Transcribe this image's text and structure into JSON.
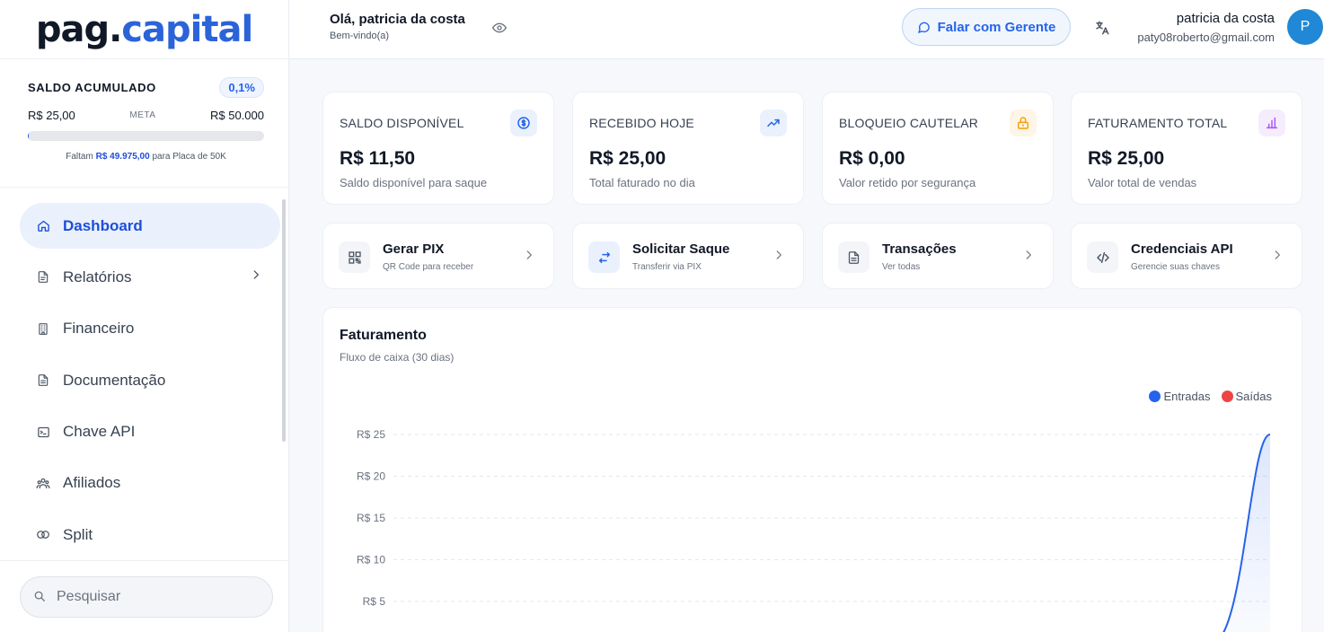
{
  "logo": {
    "part1": "pag.",
    "part2": "capital"
  },
  "saldo": {
    "title": "SALDO ACUMULADO",
    "percent": "0,1%",
    "current": "R$ 25,00",
    "meta_label": "META",
    "goal": "R$ 50.000",
    "progress_fraction": 0.0005,
    "faltam_prefix": "Faltam",
    "faltam_value": "R$ 49.975,00",
    "faltam_suffix": "para Placa de 50K"
  },
  "nav": {
    "items": [
      {
        "label": "Dashboard",
        "icon": "home-icon"
      },
      {
        "label": "Relatórios",
        "icon": "file-icon"
      },
      {
        "label": "Financeiro",
        "icon": "building-icon"
      },
      {
        "label": "Documentação",
        "icon": "document-icon"
      },
      {
        "label": "Chave API",
        "icon": "terminal-icon"
      },
      {
        "label": "Afiliados",
        "icon": "users-icon"
      },
      {
        "label": "Split",
        "icon": "split-icon"
      }
    ]
  },
  "search": {
    "placeholder": "Pesquisar"
  },
  "header": {
    "greeting": "Olá, patricia da costa",
    "welcome": "Bem-vindo(a)",
    "falar_label": "Falar com Gerente",
    "user_name": "patricia da costa",
    "user_email": "paty08roberto@gmail.com",
    "avatar_initial": "P"
  },
  "stats": [
    {
      "label": "SALDO DISPONÍVEL",
      "value": "R$ 11,50",
      "desc": "Saldo disponível para saque",
      "icon": "dollar-icon",
      "color": "#2563eb",
      "bg": "#eaf1fd"
    },
    {
      "label": "RECEBIDO HOJE",
      "value": "R$ 25,00",
      "desc": "Total faturado no dia",
      "icon": "trending-up-icon",
      "color": "#2563eb",
      "bg": "#eaf1fd"
    },
    {
      "label": "BLOQUEIO CAUTELAR",
      "value": "R$ 0,00",
      "desc": "Valor retido por segurança",
      "icon": "lock-icon",
      "color": "#f59e0b",
      "bg": "#fff5e6"
    },
    {
      "label": "FATURAMENTO TOTAL",
      "value": "R$ 25,00",
      "desc": "Valor total de vendas",
      "icon": "bar-chart-icon",
      "color": "#a855f7",
      "bg": "#f5edfd"
    }
  ],
  "actions": [
    {
      "title": "Gerar PIX",
      "sub": "QR Code para receber",
      "icon": "qr-code-icon"
    },
    {
      "title": "Solicitar Saque",
      "sub": "Transferir via PIX",
      "icon": "transfer-icon"
    },
    {
      "title": "Transações",
      "sub": "Ver todas",
      "icon": "document-icon"
    },
    {
      "title": "Credenciais API",
      "sub": "Gerencie suas chaves",
      "icon": "code-icon"
    }
  ],
  "chart": {
    "title": "Faturamento",
    "subtitle": "Fluxo de caixa (30 dias)"
  },
  "chart_data": {
    "type": "area",
    "title": "Faturamento",
    "ytick_labels": [
      "R$ 25",
      "R$ 20",
      "R$ 15",
      "R$ 10",
      "R$ 5"
    ],
    "yticks": [
      25,
      20,
      15,
      10,
      5
    ],
    "ylim": [
      0,
      25
    ],
    "grid": true,
    "legend_position": "top-right",
    "series": [
      {
        "name": "Entradas",
        "color": "#2563eb",
        "x": [
          0,
          28,
          30
        ],
        "values": [
          0,
          0,
          25
        ]
      },
      {
        "name": "Saídas",
        "color": "#ef4444",
        "x": [
          0,
          30
        ],
        "values": [
          0,
          0
        ]
      }
    ]
  }
}
